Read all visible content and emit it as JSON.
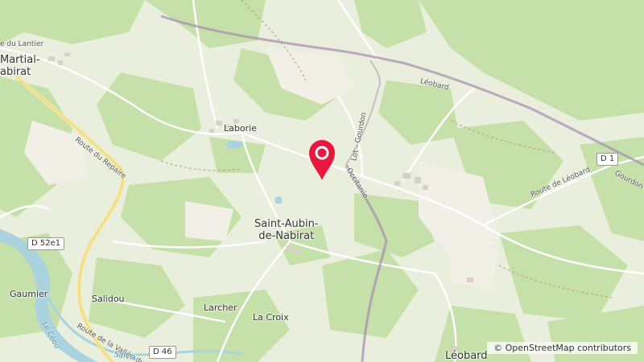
{
  "map": {
    "pin_color": "#e8173f",
    "places": [
      {
        "key": "laborie",
        "text": "Laborie"
      },
      {
        "key": "saint_aubin",
        "text": "Saint-Aubin-\nde-Nabirat"
      },
      {
        "key": "martial",
        "text": "Martial-\nabirat"
      },
      {
        "key": "gaumier",
        "text": "Gaumier"
      },
      {
        "key": "salidou",
        "text": "Salidou"
      },
      {
        "key": "larcher",
        "text": "Larcher"
      },
      {
        "key": "la_croix",
        "text": "La Croix"
      },
      {
        "key": "leobard_s",
        "text": "Léobard"
      }
    ],
    "roads": {
      "lantier": "e du Lantier",
      "repaire": "Route du Repaire",
      "vallee_ceou": "Route de la Vallée du Céou",
      "route_leobard": "Route de Léobard",
      "gourdon_e": "Gourdon",
      "leobard_n": "Léobard",
      "lot_gourdon": "Lot - Gourdon",
      "occitanie": "Occitanie",
      "le_ceou": "Le Céou",
      "salvia": "Salvia"
    },
    "shields": {
      "d1": "D 1",
      "d52e1": "D 52e1",
      "d46": "D 46"
    },
    "attribution": {
      "symbol": "©",
      "text": "OpenStreetMap contributors"
    }
  }
}
